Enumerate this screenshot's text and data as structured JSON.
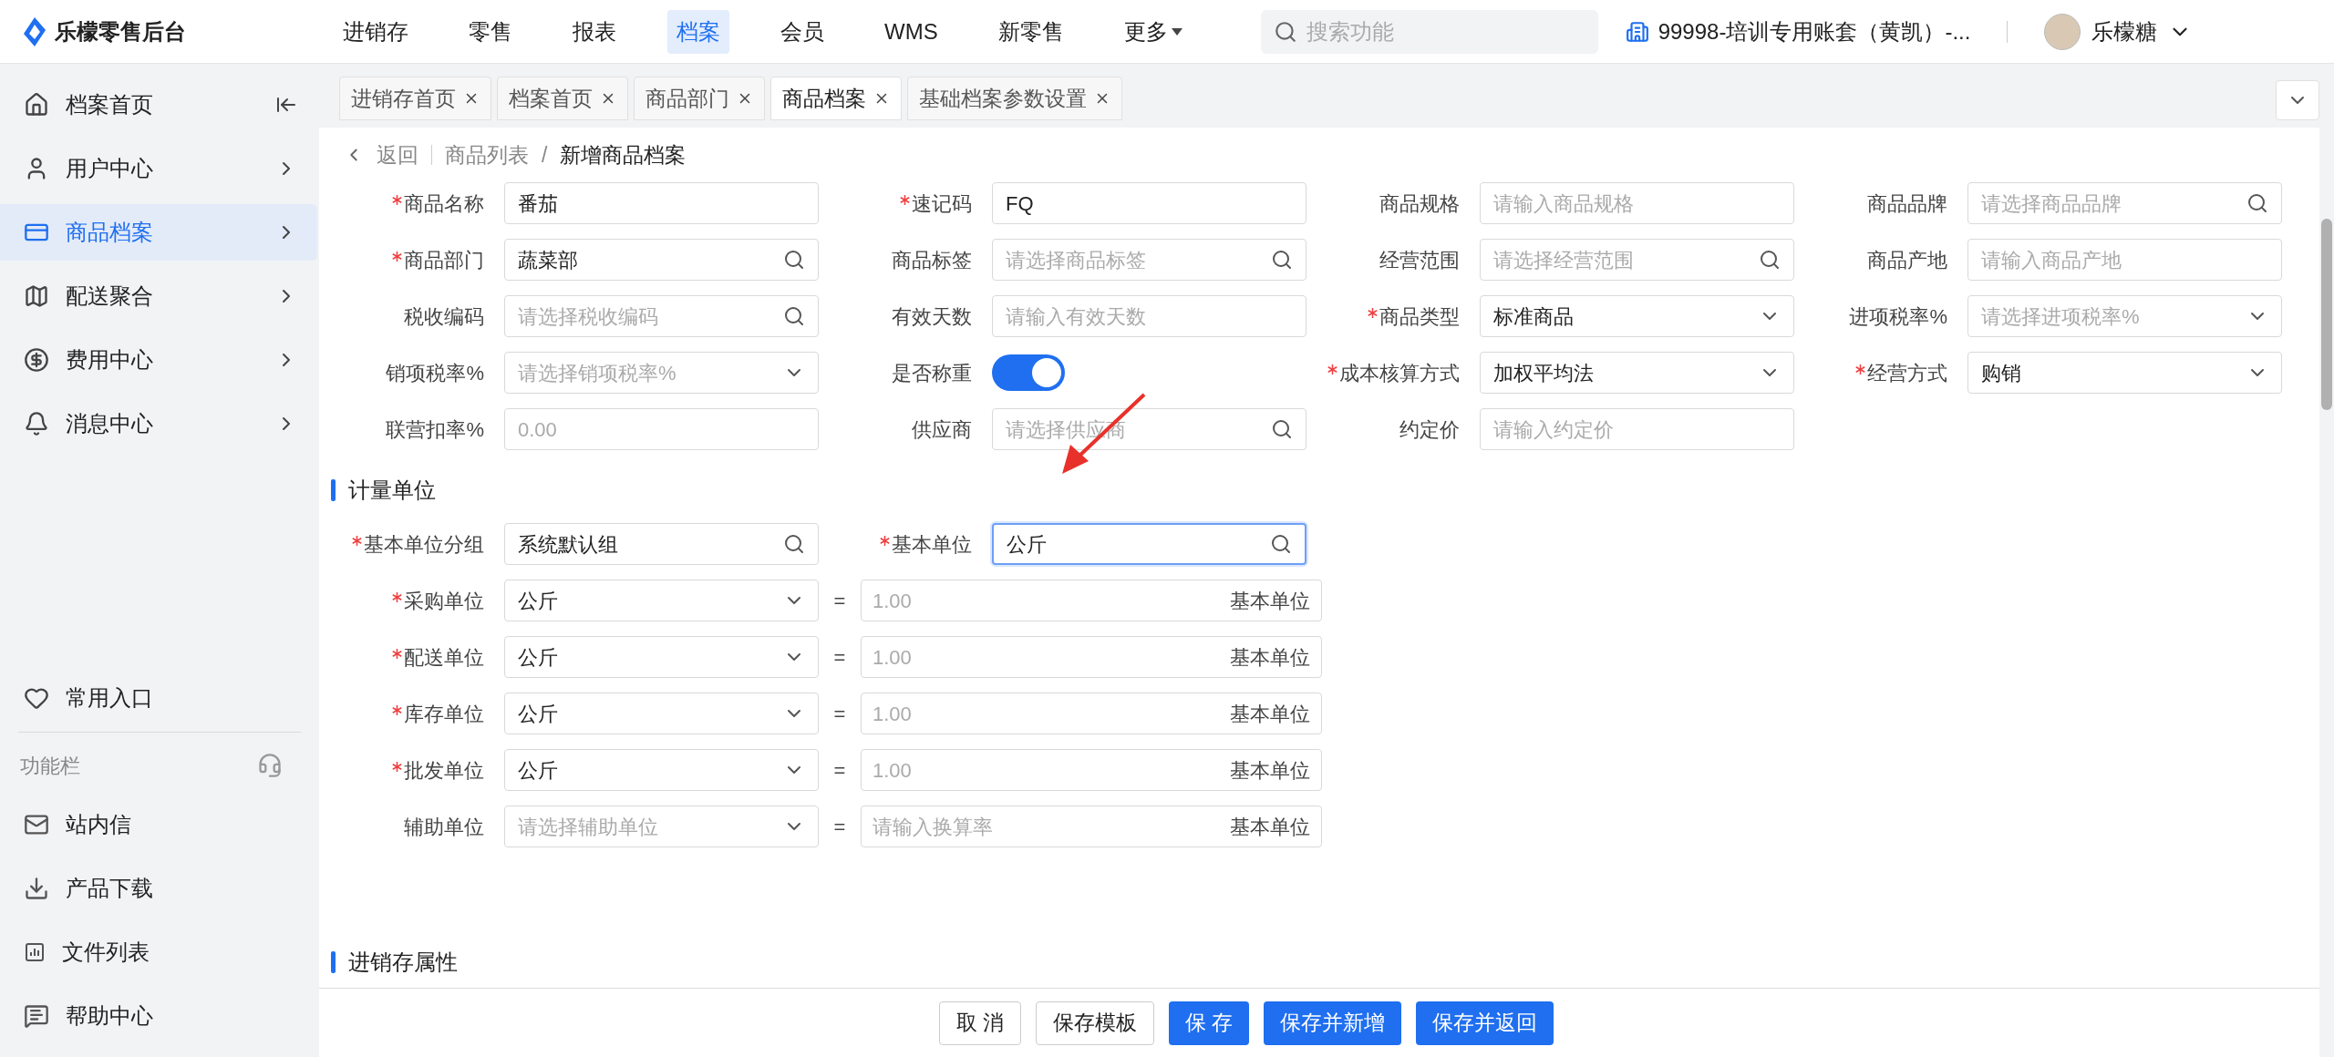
{
  "topbar": {
    "logo_text": "乐檬零售后台",
    "nav": [
      {
        "label": "进销存",
        "selected": false,
        "dropdown": false
      },
      {
        "label": "零售",
        "selected": false,
        "dropdown": false
      },
      {
        "label": "报表",
        "selected": false,
        "dropdown": false
      },
      {
        "label": "档案",
        "selected": true,
        "dropdown": false
      },
      {
        "label": "会员",
        "selected": false,
        "dropdown": false
      },
      {
        "label": "WMS",
        "selected": false,
        "dropdown": false
      },
      {
        "label": "新零售",
        "selected": false,
        "dropdown": false
      },
      {
        "label": "更多",
        "selected": false,
        "dropdown": true
      }
    ],
    "search": {
      "placeholder": "搜索功能"
    },
    "account": "99998-培训专用账套（黄凯）-...",
    "user": "乐檬糖"
  },
  "tabs": [
    {
      "label": "进销存首页",
      "selected": false
    },
    {
      "label": "档案首页",
      "selected": false
    },
    {
      "label": "商品部门",
      "selected": false
    },
    {
      "label": "商品档案",
      "selected": true
    },
    {
      "label": "基础档案参数设置",
      "selected": false
    }
  ],
  "sidebar": {
    "items": [
      {
        "label": "档案首页",
        "selected": false
      },
      {
        "label": "用户中心",
        "selected": false
      },
      {
        "label": "商品档案",
        "selected": true
      },
      {
        "label": "配送聚合",
        "selected": false
      },
      {
        "label": "费用中心",
        "selected": false
      },
      {
        "label": "消息中心",
        "selected": false
      }
    ],
    "favorites": "常用入口",
    "tools_title": "功能栏",
    "tools": [
      {
        "label": "站内信"
      },
      {
        "label": "产品下载"
      },
      {
        "label": "文件列表"
      },
      {
        "label": "帮助中心"
      }
    ]
  },
  "breadcrumb": {
    "back": "返回",
    "separator": "/",
    "path": [
      "商品列表",
      "新增商品档案"
    ]
  },
  "basic_fields": [
    {
      "label": "商品名称",
      "required": true,
      "kind": "input",
      "value": "番茄"
    },
    {
      "label": "速记码",
      "required": true,
      "kind": "input",
      "value": "FQ"
    },
    {
      "label": "商品规格",
      "required": false,
      "kind": "input",
      "placeholder": "请输入商品规格"
    },
    {
      "label": "商品品牌",
      "required": false,
      "kind": "search",
      "placeholder": "请选择商品品牌"
    },
    {
      "label": "商品部门",
      "required": true,
      "kind": "search",
      "value": "蔬菜部"
    },
    {
      "label": "商品标签",
      "required": false,
      "kind": "search",
      "placeholder": "请选择商品标签"
    },
    {
      "label": "经营范围",
      "required": false,
      "kind": "search",
      "placeholder": "请选择经营范围"
    },
    {
      "label": "商品产地",
      "required": false,
      "kind": "input",
      "placeholder": "请输入商品产地"
    },
    {
      "label": "税收编码",
      "required": false,
      "kind": "search",
      "placeholder": "请选择税收编码"
    },
    {
      "label": "有效天数",
      "required": false,
      "kind": "input",
      "placeholder": "请输入有效天数"
    },
    {
      "label": "商品类型",
      "required": true,
      "kind": "select",
      "value": "标准商品"
    },
    {
      "label": "进项税率%",
      "required": false,
      "kind": "select",
      "placeholder": "请选择进项税率%"
    },
    {
      "label": "销项税率%",
      "required": false,
      "kind": "select",
      "placeholder": "请选择销项税率%"
    },
    {
      "label": "是否称重",
      "required": false,
      "kind": "switch",
      "on": true
    },
    {
      "label": "成本核算方式",
      "required": true,
      "kind": "select",
      "value": "加权平均法"
    },
    {
      "label": "经营方式",
      "required": true,
      "kind": "select",
      "value": "购销"
    },
    {
      "label": "联营扣率%",
      "required": false,
      "kind": "input",
      "placeholder": "0.00"
    },
    {
      "label": "供应商",
      "required": false,
      "kind": "search",
      "placeholder": "请选择供应商"
    },
    {
      "label": "约定价",
      "required": false,
      "kind": "input",
      "placeholder": "请输入约定价"
    }
  ],
  "unit_section": {
    "title": "计量单位",
    "base_fields": [
      {
        "label": "基本单位分组",
        "required": true,
        "value": "系统默认组",
        "focused": false
      },
      {
        "label": "基本单位",
        "required": true,
        "value": "公斤",
        "focused": true
      }
    ],
    "unit_rows": [
      {
        "label": "采购单位",
        "required": true,
        "value": "公斤",
        "rate_placeholder": "1.00",
        "suffix": "基本单位"
      },
      {
        "label": "配送单位",
        "required": true,
        "value": "公斤",
        "rate_placeholder": "1.00",
        "suffix": "基本单位"
      },
      {
        "label": "库存单位",
        "required": true,
        "value": "公斤",
        "rate_placeholder": "1.00",
        "suffix": "基本单位"
      },
      {
        "label": "批发单位",
        "required": true,
        "value": "公斤",
        "rate_placeholder": "1.00",
        "suffix": "基本单位"
      },
      {
        "label": "辅助单位",
        "required": false,
        "placeholder": "请选择辅助单位",
        "rate_placeholder": "请输入换算率",
        "suffix": "基本单位"
      }
    ],
    "equals": "="
  },
  "stock_section": {
    "title": "进销存属性"
  },
  "footer": {
    "buttons": [
      {
        "label": "取 消",
        "primary": false
      },
      {
        "label": "保存模板",
        "primary": false
      },
      {
        "label": "保 存",
        "primary": true
      },
      {
        "label": "保存并新增",
        "primary": true
      },
      {
        "label": "保存并返回",
        "primary": true
      }
    ]
  }
}
